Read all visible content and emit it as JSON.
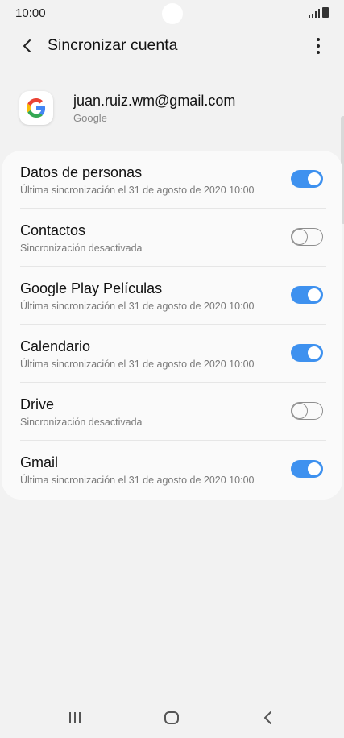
{
  "status_bar": {
    "time": "10:00"
  },
  "header": {
    "title": "Sincronizar cuenta"
  },
  "account": {
    "email": "juan.ruiz.wm@gmail.com",
    "provider": "Google"
  },
  "sync_items": [
    {
      "name": "Datos de personas",
      "status": "Última sincronización el 31 de agosto de 2020 10:00",
      "enabled": true
    },
    {
      "name": "Contactos",
      "status": "Sincronización desactivada",
      "enabled": false
    },
    {
      "name": "Google Play Películas",
      "status": "Última sincronización el 31 de agosto de 2020 10:00",
      "enabled": true
    },
    {
      "name": "Calendario",
      "status": "Última sincronización el 31 de agosto de 2020 10:00",
      "enabled": true
    },
    {
      "name": "Drive",
      "status": "Sincronización desactivada",
      "enabled": false
    },
    {
      "name": "Gmail",
      "status": "Última sincronización el 31 de agosto de 2020 10:00",
      "enabled": true
    }
  ],
  "colors": {
    "accent": "#3e91ef",
    "background": "#f2f2f2",
    "card": "#fafafa"
  },
  "icons": {
    "back": "back-arrow-icon",
    "menu": "more-vert-icon",
    "account": "google-logo-icon",
    "nav_recents": "recents-icon",
    "nav_home": "home-icon",
    "nav_back": "nav-back-icon"
  }
}
